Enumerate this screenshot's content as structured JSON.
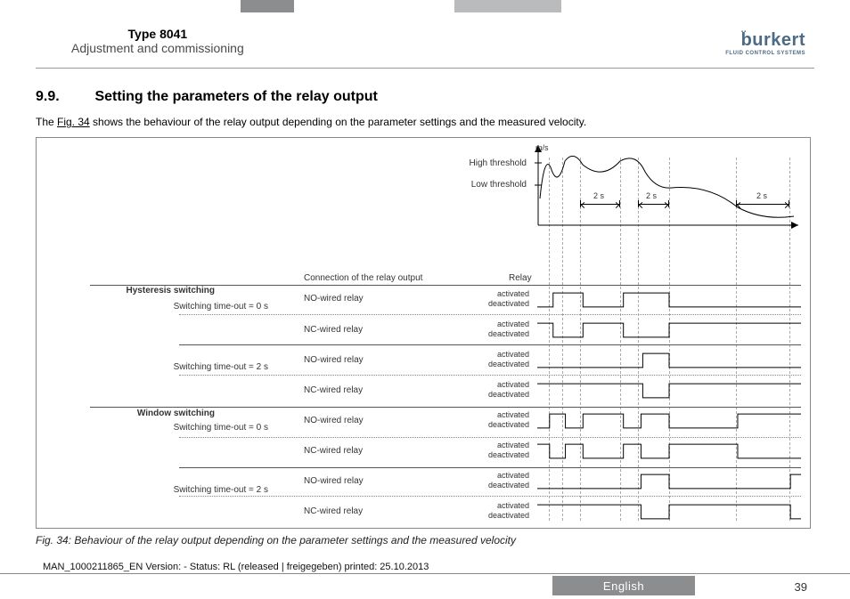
{
  "header": {
    "type_line": "Type 8041",
    "subtitle": "Adjustment and commissioning",
    "brand": "burkert",
    "brand_tag": "FLUID CONTROL SYSTEMS"
  },
  "section": {
    "number": "9.9.",
    "title": "Setting the parameters of the relay output",
    "lead_before": "The ",
    "lead_link": "Fig. 34",
    "lead_after": " shows the behaviour of the relay output depending on the parameter settings and the measured velocity."
  },
  "diagram": {
    "unit": "m/s",
    "high_threshold": "High threshold",
    "low_threshold": "Low threshold",
    "span_label": "2 s",
    "col_connection": "Connection of the relay output",
    "col_relay": "Relay",
    "hysteresis_heading": "Hysteresis switching",
    "window_heading": "Window switching",
    "timeout0": "Switching time-out = 0 s",
    "timeout2": "Switching time-out = 2 s",
    "no_relay": "NO-wired relay",
    "nc_relay": "NC-wired relay",
    "activated": "activated",
    "deactivated": "deactivated"
  },
  "caption": "Fig. 34:  Behaviour of the relay output depending on the parameter settings and the measured velocity",
  "footer": {
    "status": "MAN_1000211865_EN  Version: - Status: RL (released | freigegeben)  printed: 25.10.2013",
    "language": "English",
    "page": "39"
  }
}
